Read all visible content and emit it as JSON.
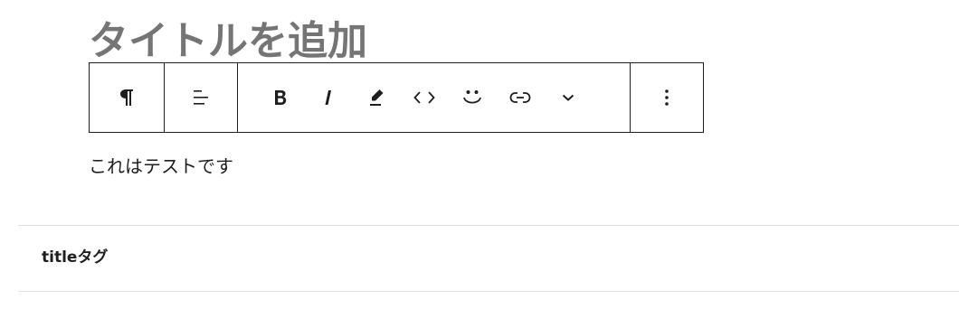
{
  "editor": {
    "title_placeholder": "タイトルを追加",
    "paragraph_text": "これはテストです"
  },
  "toolbar": {
    "block_type_icon": "paragraph-icon",
    "align_icon": "align-icon",
    "format_icons": [
      "bold-icon",
      "italic-icon",
      "highlight-icon",
      "code-icon",
      "emoji-icon",
      "link-icon",
      "chevron-down-icon"
    ],
    "more_icon": "more-options-icon"
  },
  "settings": {
    "section_label": "titleタグ"
  }
}
